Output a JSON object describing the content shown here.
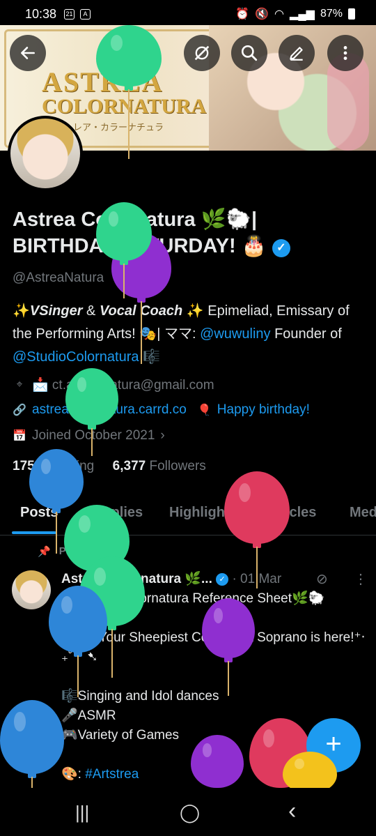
{
  "status_bar": {
    "time": "10:38",
    "icon_1": "21",
    "icon_2": "A",
    "battery": "87%"
  },
  "banner": {
    "logo_line1": "ASTREA",
    "logo_line2": "COLORNATURA",
    "logo_kana": "アストレア・カラーナチュラ"
  },
  "toolbar": {
    "back_icon": "arrow-left-icon",
    "mute_icon": "eye-slash-icon",
    "search_icon": "search-icon",
    "edit_icon": "pencil-icon",
    "more_icon": "more-vertical-icon"
  },
  "profile": {
    "name_line1": "Astrea Colornatura 🌿🐑|",
    "name_line2": "BIRTHDAY SATURDAY! 🎂",
    "verified_mark": "✓",
    "handle": "@AstreaNatura",
    "bio": {
      "p1_sparkle": "✨",
      "p1_bold1": "VSinger",
      "p1_amp": " & ",
      "p1_bold2": "Vocal Coach",
      "p1_rest": " ✨ Epimeliad, Emissary of the Performing Arts! 🎭| ママ: ",
      "mention1": "@wuwuliny",
      "p1_founder": " Founder of ",
      "mention2": "@StudioColornatura",
      "p1_end": " 🎼"
    },
    "email": "📩 ct.astreanatura@gmail.com",
    "website": "astreacolornatura.carrd.co",
    "birthday": "Happy birthday!",
    "joined": "Joined October 2021",
    "following_count": "175",
    "following_label": "Following",
    "followers_count": "6,377",
    "followers_label": "Followers"
  },
  "tabs": [
    {
      "label": "Posts",
      "active": true
    },
    {
      "label": "Replies"
    },
    {
      "label": "Highlights"
    },
    {
      "label": "Articles"
    },
    {
      "label": "Media"
    }
  ],
  "pinned_label": "Pinned",
  "tweet": {
    "author": "Astrea Colornatura 🌿...",
    "dot": "·",
    "date": "01 Mar",
    "body": "✨Astrea Colornatura Reference Sheet🌿🐑\n\n⁺‧₊˚ ✦Your Sheepiest Coloratura Soprano is here!⁺‧₊˚ ⁀➷\n\n🎼Singing and Idol dances\n🎤ASMR\n🎮Variety of Games\n\n🎨: ",
    "hashtag": "#Artstrea"
  },
  "fab": "+",
  "nav": {
    "recents": "|||",
    "home": "◯",
    "back": "‹"
  }
}
